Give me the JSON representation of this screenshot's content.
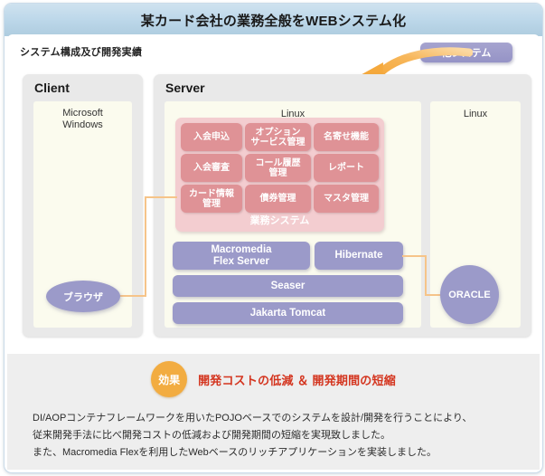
{
  "header": {
    "title": "某カード会社の業務全般をWEBシステム化"
  },
  "diagram": {
    "section_label": "システム構成及び開発実績",
    "other_system_badge": "他システム",
    "client": {
      "panel_title": "Client",
      "os_label": "Microsoft\nWindows",
      "os_label_line1": "Microsoft",
      "os_label_line2": "Windows",
      "browser_node": "ブラウザ"
    },
    "server": {
      "panel_title": "Server",
      "app_os_label": "Linux",
      "db_os_label": "Linux",
      "business_system": {
        "caption": "業務システム",
        "modules": [
          "入会申込",
          "オプション\nサービス管理",
          "名寄せ機能",
          "入会審査",
          "コール履歴\n管理",
          "レポート",
          "カード情報\n管理",
          "債券管理",
          "マスタ管理"
        ]
      },
      "middleware": [
        "Macromedia\nFlex Server",
        "Hibernate",
        "Seaser",
        "Jakarta Tomcat"
      ],
      "database_node": "ORACLE"
    }
  },
  "effect": {
    "badge": "効果",
    "headline": "開発コストの低減 ＆ 開発期間の短縮",
    "description_lines": [
      "DI/AOPコンテナフレームワークを用いたPOJOベースでのシステムを設計/開発を行うことにより、",
      "従来開発手法に比べ開発コストの低減および開発期間の短縮を実現致しました。",
      "また、Macromedia Flexを利用したWebベースのリッチアプリケーションを実装しました。"
    ]
  },
  "colors": {
    "title_bar": "#bdd8ea",
    "panel_gray": "#e9e9e9",
    "panel_cream": "#fbfbee",
    "module_pink": "#df9296",
    "business_pink": "#f3cdd0",
    "middleware_purple": "#9b9ac9",
    "connector_orange": "#f6c489",
    "arrow_orange": "#f5a93d",
    "effect_circle": "#f2ac41",
    "effect_text_red": "#d4351f"
  }
}
